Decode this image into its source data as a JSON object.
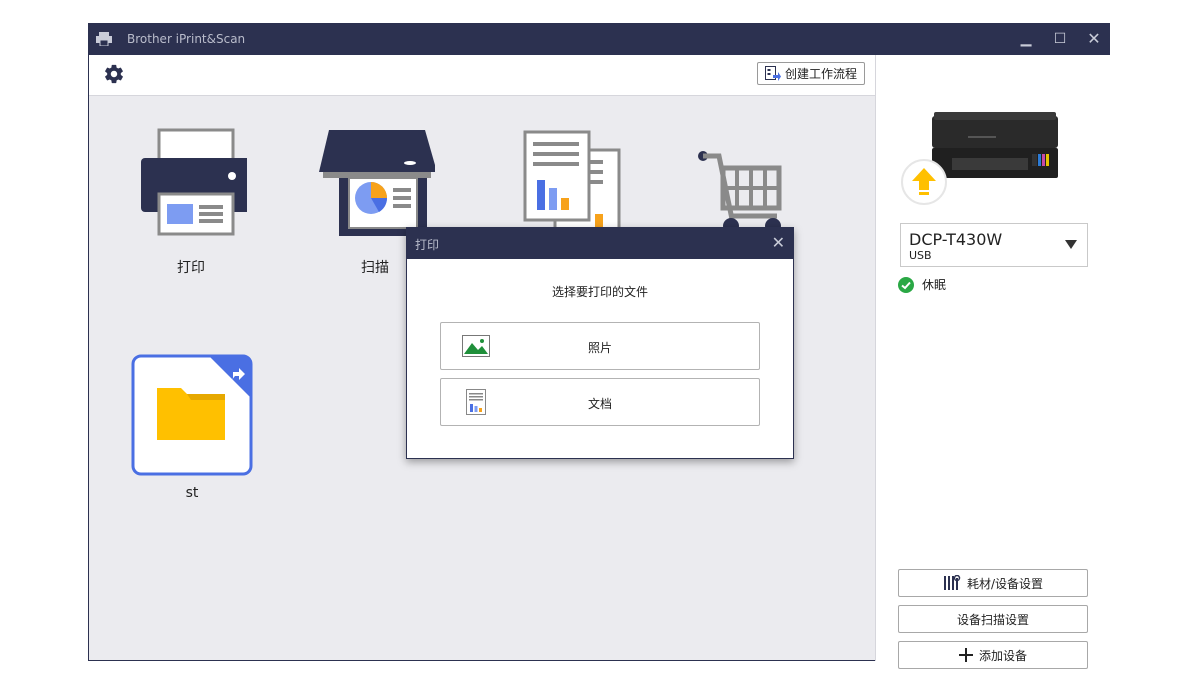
{
  "window": {
    "title": "Brother iPrint&Scan",
    "controls": {
      "minimize": "▁",
      "maximize": "☐",
      "close": "✕"
    }
  },
  "toolbar": {
    "settings_icon": "gear-icon",
    "create_workflow_label": "创建工作流程",
    "create_workflow_icon": "workflow-icon"
  },
  "tiles": [
    {
      "label": "打印",
      "icon": "printer-icon"
    },
    {
      "label": "扫描",
      "icon": "scanner-icon"
    },
    {
      "label": "",
      "icon": "documents-icon"
    },
    {
      "label": "",
      "icon": "shopping-cart-icon"
    },
    {
      "label": "st",
      "icon": "folder-shortcut-icon"
    }
  ],
  "sidebar": {
    "device_image": "printer-device-image",
    "update_icon": "upload-arrow-icon",
    "device": {
      "name": "DCP-T430W",
      "connection": "USB"
    },
    "status": {
      "label": "休眠",
      "color": "#2aa845"
    },
    "buttons": {
      "supplies": "耗材/设备设置",
      "scan_settings": "设备扫描设置",
      "add_device": "添加设备"
    }
  },
  "dialog": {
    "title": "打印",
    "close": "✕",
    "prompt": "选择要打印的文件",
    "options": [
      {
        "label": "照片",
        "icon": "photo-icon"
      },
      {
        "label": "文档",
        "icon": "document-icon"
      }
    ]
  },
  "colors": {
    "titlebar": "#2c3150",
    "accent_blue": "#4a6fe3",
    "folder_yellow": "#ffc000",
    "chart_orange": "#f7a21b"
  }
}
